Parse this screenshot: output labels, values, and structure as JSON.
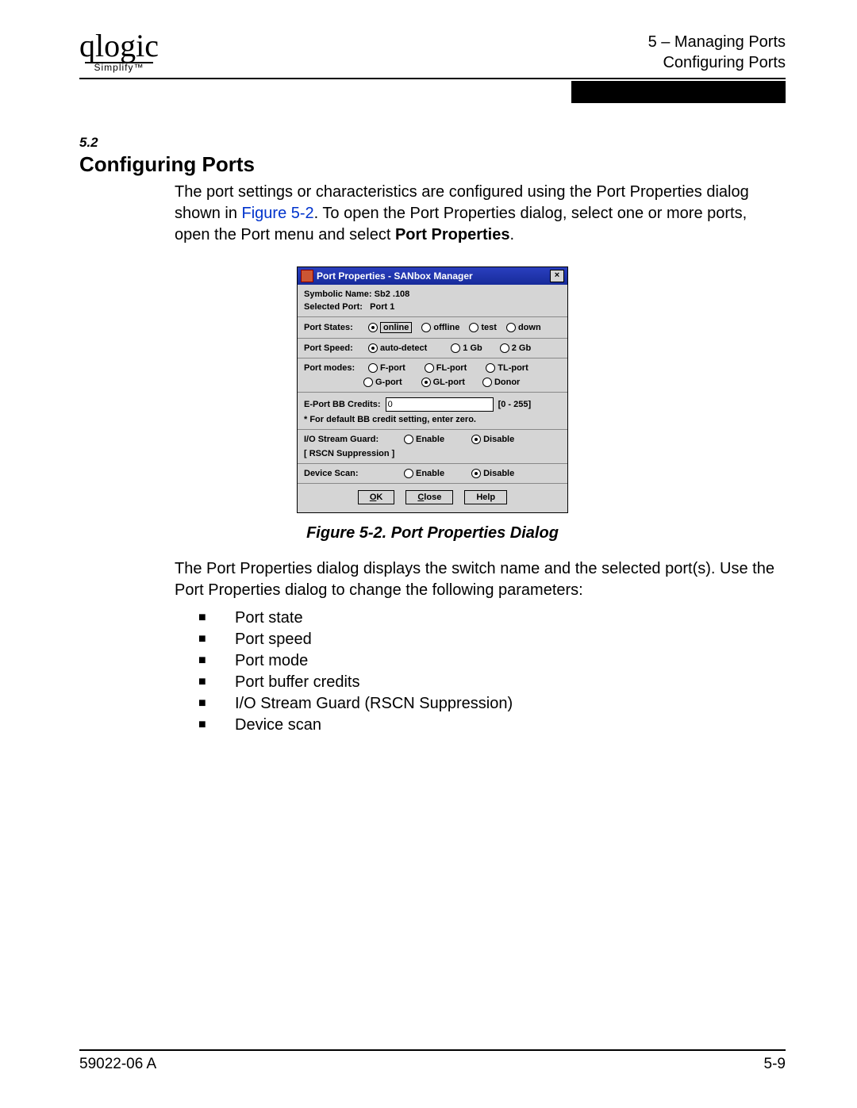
{
  "header": {
    "logo_cursive": "qlogic",
    "logo_tagline": "Simplify™",
    "line1": "5 – Managing Ports",
    "line2": "Configuring Ports"
  },
  "section": {
    "number": "5.2",
    "title": "Configuring Ports",
    "intro_part1": "The port settings or characteristics are configured using the Port Properties dialog shown in ",
    "fig_ref": "Figure 5-2",
    "intro_part2": ". To open the Port Properties dialog, select one or more ports, open the Port menu and select ",
    "bold_menu": "Port Properties",
    "intro_part3": "."
  },
  "dialog": {
    "title": "Port Properties - SANbox Manager",
    "symbolic_label": "Symbolic Name:",
    "symbolic_value": "Sb2 .108",
    "selected_label": "Selected Port:",
    "selected_value": "Port 1",
    "port_states_label": "Port States:",
    "states": {
      "online": "online",
      "offline": "offline",
      "test": "test",
      "down": "down"
    },
    "port_speed_label": "Port Speed:",
    "speeds": {
      "auto": "auto-detect",
      "g1": "1 Gb",
      "g2": "2 Gb"
    },
    "port_modes_label": "Port modes:",
    "modes": {
      "f": "F-port",
      "fl": "FL-port",
      "tl": "TL-port",
      "g": "G-port",
      "gl": "GL-port",
      "donor": "Donor"
    },
    "credits_label": "E-Port BB Credits:",
    "credits_value": "0",
    "credits_range": "[0 - 255]",
    "credits_note": "* For default BB credit setting, enter zero.",
    "io_label": "I/O Stream Guard:",
    "enable": "Enable",
    "disable": "Disable",
    "rscn": "[ RSCN Suppression ]",
    "scan_label": "Device Scan:",
    "btn_ok": "OK",
    "btn_ok_u": "O",
    "btn_ok_rest": "K",
    "btn_close": "Close",
    "btn_close_u": "C",
    "btn_close_rest": "lose",
    "btn_help": "Help"
  },
  "figure_caption": "Figure 5-2.  Port Properties Dialog",
  "para2": "The Port Properties dialog displays the switch name and the selected port(s). Use the Port Properties dialog to change the following parameters:",
  "bullets": [
    "Port state",
    "Port speed",
    "Port mode",
    "Port buffer credits",
    "I/O Stream Guard (RSCN Suppression)",
    "Device scan"
  ],
  "footer": {
    "left": "59022-06  A",
    "right": "5-9"
  }
}
